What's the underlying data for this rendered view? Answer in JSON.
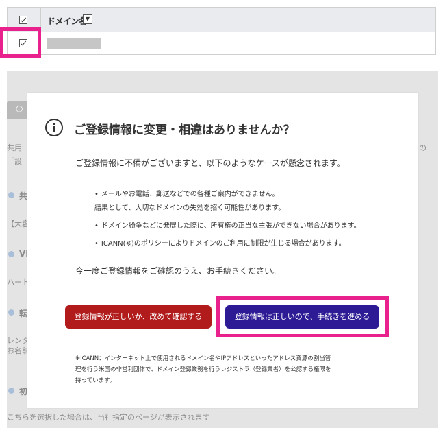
{
  "table": {
    "column_title": "ドメイン名",
    "sort_icon": "▼",
    "header_checkbox_checked": true,
    "row_checkbox_checked": true
  },
  "background": {
    "tab_icon": "○",
    "line1": "共用",
    "line1_right": "の",
    "line2": "「設",
    "heading1": "共",
    "line3": "【大容",
    "heading2": "VI",
    "line4": "ハート",
    "heading3": "転",
    "line5": "レンタ",
    "line6": "お名前",
    "heading4": "初",
    "bottom_text": "こちらを選択した場合は、当社指定のページが表示されます"
  },
  "modal": {
    "title": "ご登録情報に変更・相違はありませんか？",
    "intro": "ご登録情報に不備がございますと、以下のようなケースが懸念されます。",
    "bullets": [
      "メールやお電話、郵送などでの各種ご案内ができません。",
      "結果として、大切なドメインの失効を招く可能性があります。",
      "ドメイン紛争などに発展した際に、所有権の正当な主張ができない場合があります。",
      "ICANN(※)のポリシーによりドメインのご利用に制限が生じる場合があります。"
    ],
    "confirm": "今一度ご登録情報をご確認のうえ、お手続きください。",
    "btn_recheck": "登録情報が正しいか、改めて確認する",
    "btn_proceed": "登録情報は正しいので、手続きを進める",
    "footnote": [
      "※ICANN：インターネット上で使用されるドメイン名やIPアドレスといったアドレス資源の割当管",
      "理を行う米国の非営利団体で、ドメイン登録業務を行うレジストラ（登録業者）を公認する権限を",
      "持っています。"
    ]
  },
  "colors": {
    "highlight": "#e8218c",
    "recheck_button": "#b11b1c",
    "proceed_button": "#2d1b96"
  }
}
